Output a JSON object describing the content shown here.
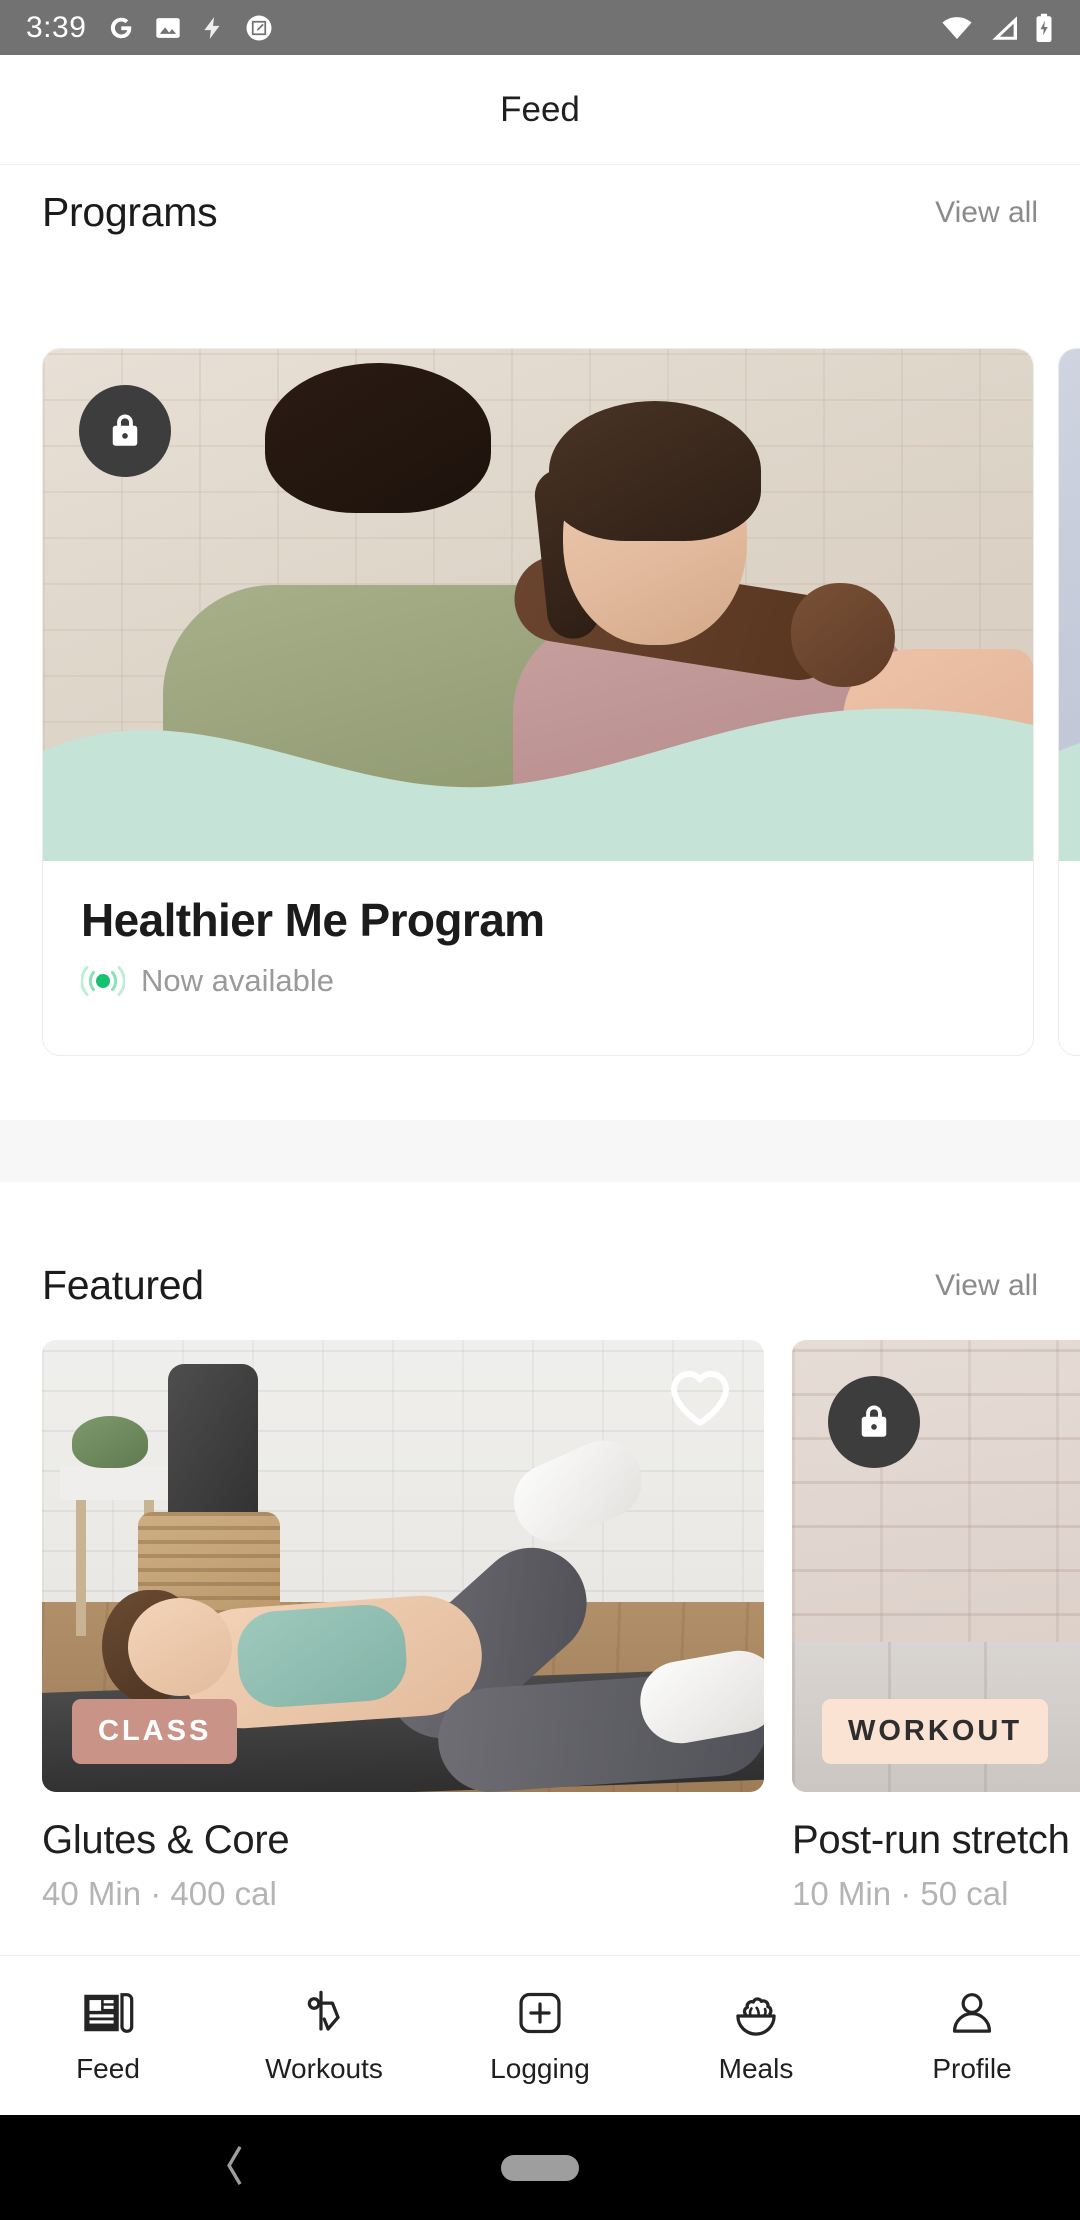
{
  "status_bar": {
    "time": "3:39",
    "left_icons": [
      "google-icon",
      "photo-icon",
      "flash-icon",
      "screenshot-edit-icon"
    ],
    "right_icons": [
      "wifi-icon",
      "cellular-signal-icon",
      "battery-charging-icon"
    ],
    "background": "#727272"
  },
  "app_bar": {
    "title": "Feed"
  },
  "sections": {
    "programs": {
      "title": "Programs",
      "view_all": "View all",
      "cards": [
        {
          "title": "Healthier Me Program",
          "status": "Now available",
          "status_icon": "broadcast-live-icon",
          "locked": true,
          "lock_icon": "lock-icon",
          "wave_color": "#c5e3d7"
        },
        {
          "title": "",
          "status": "",
          "locked": false,
          "wave_color": "#c5e3d7"
        }
      ]
    },
    "featured": {
      "title": "Featured",
      "view_all": "View all",
      "cards": [
        {
          "badge": "CLASS",
          "badge_color": "#c99388",
          "badge_text_color": "#ffffff",
          "title": "Glutes & Core",
          "meta": "40 Min · 400 cal",
          "favorite_icon": "heart-outline-icon",
          "favorited": false,
          "locked": false
        },
        {
          "badge": "WORKOUT",
          "badge_color": "#fae3d2",
          "badge_text_color": "#2e2e2e",
          "title": "Post-run stretch",
          "meta": "10 Min · 50 cal",
          "locked": true,
          "lock_icon": "lock-icon"
        }
      ]
    }
  },
  "bottom_nav": {
    "active": "Feed",
    "items": [
      {
        "label": "Feed",
        "icon": "feed-icon",
        "active": true
      },
      {
        "label": "Workouts",
        "icon": "workouts-stretch-icon",
        "active": false
      },
      {
        "label": "Logging",
        "icon": "plus-square-icon",
        "active": false
      },
      {
        "label": "Meals",
        "icon": "salad-bowl-icon",
        "active": false
      },
      {
        "label": "Profile",
        "icon": "person-icon",
        "active": false
      }
    ]
  },
  "system_nav": {
    "back_icon": "back-chevron-icon",
    "home_icon": "home-pill-icon"
  },
  "theme": {
    "accent_green": "#16c172",
    "mint": "#c5e3d7",
    "muted_text": "#9a9a9a",
    "dark_text": "#1b1b1b"
  }
}
